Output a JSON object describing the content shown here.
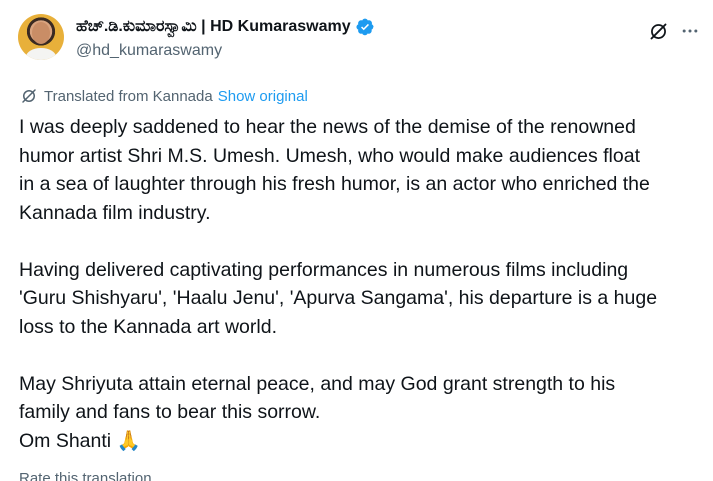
{
  "author": {
    "display_name": "ಹೆಚ್.ಡಿ.ಕುಮಾರಸ್ವಾಮಿ | HD Kumaraswamy",
    "handle": "@hd_kumaraswamy",
    "verified": true,
    "verified_color": "#1d9bf0"
  },
  "translation": {
    "label": "Translated from Kannada",
    "show_original": "Show original",
    "rate_label": "Rate this translation"
  },
  "tweet": {
    "paragraphs": [
      [
        "I was deeply saddened to hear the news of the demise of the renowned",
        "humor artist Shri M.S. Umesh. Umesh, who would make audiences float",
        "in a sea of laughter through his fresh humor, is an actor who enriched the",
        "Kannada film industry."
      ],
      [
        "Having delivered captivating performances in numerous films including",
        "'Guru Shishyaru', 'Haalu Jenu', 'Apurva Sangama', his departure is a huge",
        "loss to the Kannada art world."
      ],
      [
        "May Shriyuta attain eternal peace, and may God grant strength to his",
        "family and fans to bear this sorrow.",
        "Om Shanti 🙏"
      ]
    ]
  },
  "icons": {
    "verified": "verified-badge-icon",
    "grok": "grok-icon",
    "more": "more-icon",
    "translate": "translate-icon"
  }
}
